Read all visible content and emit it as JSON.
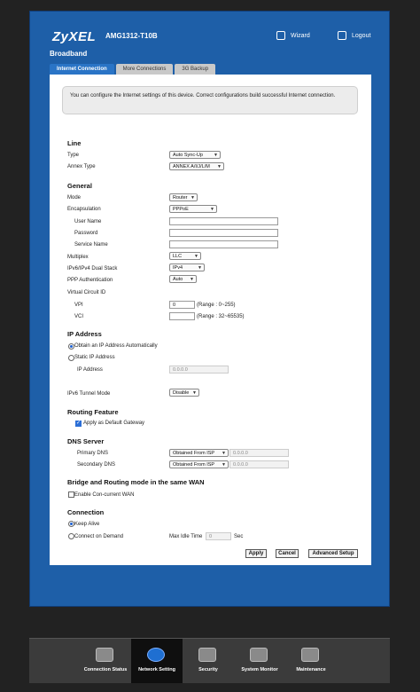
{
  "header": {
    "brand": "ZyXEL",
    "model": "AMG1312-T10B",
    "wizard_label": "Wizard",
    "logout_label": "Logout",
    "page_title": "Broadband"
  },
  "tabs": [
    {
      "label": "Internet Connection",
      "active": true
    },
    {
      "label": "More Connections",
      "active": false
    },
    {
      "label": "3G Backup",
      "active": false
    }
  ],
  "notice": "You can configure the Internet settings of this device. Correct configurations build successful Internet connection.",
  "line": {
    "title": "Line",
    "type_label": "Type",
    "type_value": "Auto Sync-Up",
    "annex_label": "Annex Type",
    "annex_value": "ANNEX A/I/J/L/M"
  },
  "general": {
    "title": "General",
    "mode_label": "Mode",
    "mode_value": "Router",
    "encap_label": "Encapsulation",
    "encap_value": "PPPoE",
    "username_label": "User Name",
    "username_value": "",
    "password_label": "Password",
    "password_value": "",
    "service_label": "Service Name",
    "service_value": "",
    "multiplex_label": "Multiplex",
    "multiplex_value": "LLC",
    "dualstack_label": "IPv6/IPv4 Dual Stack",
    "dualstack_value": "IPv4",
    "pppauth_label": "PPP Authentication",
    "pppauth_value": "Auto",
    "vc_label": "Virtual Circuit ID",
    "vpi_label": "VPI",
    "vpi_value": "0",
    "vpi_range": "(Range : 0~255)",
    "vci_label": "VCI",
    "vci_value": "",
    "vci_range": "(Range : 32~65535)"
  },
  "ip": {
    "title": "IP Address",
    "auto_label": "Obtain an IP Address Automatically",
    "auto_selected": true,
    "static_label": "Static IP Address",
    "ipaddr_label": "IP Address",
    "ipaddr_value": "0.0.0.0",
    "tunnel_label": "IPv6 Tunnel Mode",
    "tunnel_value": "Disable"
  },
  "routing": {
    "title": "Routing Feature",
    "default_gw_label": "Apply as Default Gateway",
    "default_gw_checked": true
  },
  "dns": {
    "title": "DNS Server",
    "primary_label": "Primary DNS",
    "primary_mode": "Obtained From ISP",
    "primary_value": "0.0.0.0",
    "secondary_label": "Secondary DNS",
    "secondary_mode": "Obtained From ISP",
    "secondary_value": "0.0.0.0"
  },
  "bridge": {
    "title": "Bridge and Routing mode in the same WAN",
    "concurrent_label": "Enable Con-current WAN",
    "concurrent_checked": false
  },
  "connection": {
    "title": "Connection",
    "keepalive_label": "Keep Alive",
    "keepalive_selected": true,
    "ondemand_label": "Connect on Demand",
    "idle_label": "Max Idle Time",
    "idle_value": "0",
    "idle_unit": "Sec"
  },
  "buttons": {
    "apply": "Apply",
    "cancel": "Cancel",
    "advanced": "Advanced Setup"
  },
  "bottom_nav": [
    {
      "label": "Connection Status",
      "icon": "connection-status-icon",
      "active": false
    },
    {
      "label": "Network Setting",
      "icon": "network-setting-icon",
      "active": true
    },
    {
      "label": "Security",
      "icon": "security-shield-icon",
      "active": false
    },
    {
      "label": "System Monitor",
      "icon": "system-monitor-icon",
      "active": false
    },
    {
      "label": "Maintenance",
      "icon": "maintenance-icon",
      "active": false
    }
  ],
  "colors": {
    "frame_blue": "#1e5fa8",
    "active_tab": "#2a74c6",
    "nav_bar": "#3b3b3b"
  }
}
